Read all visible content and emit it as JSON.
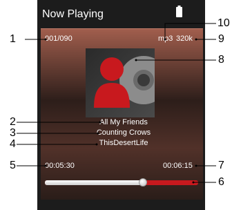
{
  "header": {
    "title": "Now Playing",
    "battery_icon": "battery-icon"
  },
  "track": {
    "index": "001/090",
    "format": "mp3",
    "bitrate": "320k",
    "title": "All My Friends",
    "artist": "Counting Crows",
    "album": "ThisDesertLife"
  },
  "progress": {
    "elapsed": "00:05:30",
    "total": "00:06:15",
    "fraction": 0.64
  },
  "album_art": {
    "icon": "generic-album-art-icon"
  },
  "callouts": {
    "n1": "1",
    "n2": "2",
    "n3": "3",
    "n4": "4",
    "n5": "5",
    "n6": "6",
    "n7": "7",
    "n8": "8",
    "n9": "9",
    "n10": "10"
  },
  "colors": {
    "accent_red": "#c8191e",
    "panel_top": "#a15e4d",
    "device_bg": "#1c1c1c"
  }
}
